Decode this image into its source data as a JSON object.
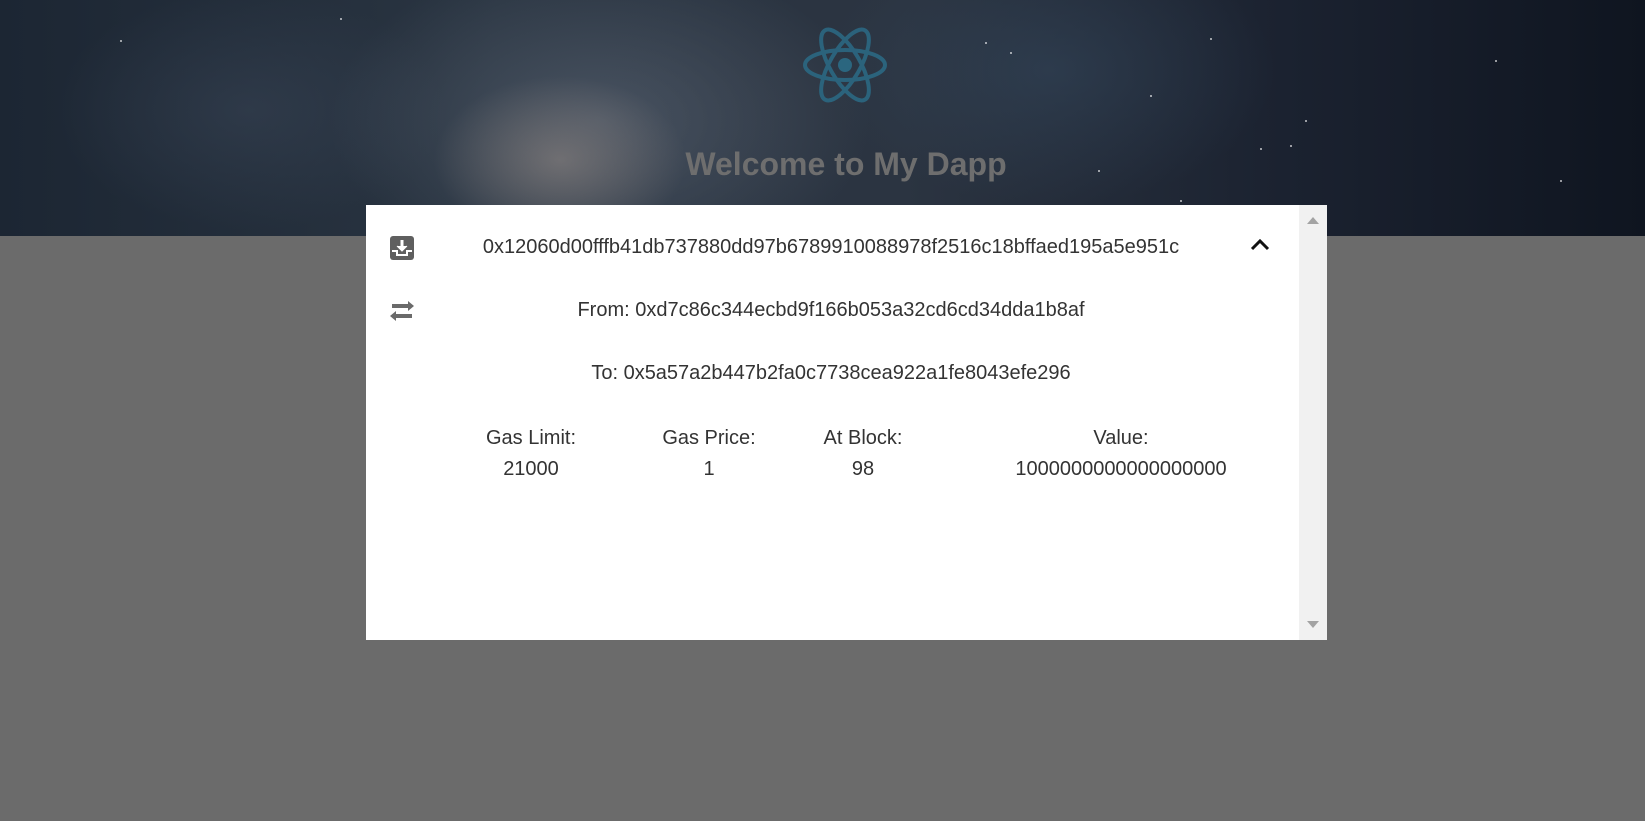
{
  "header": {
    "title": "Welcome to My Dapp",
    "logo_icon": "react-atom-icon",
    "logo_color": "#2b6b86"
  },
  "transaction": {
    "hash": "0x12060d00fffb41db737880dd97b6789910088978f2516c18bffaed195a5e951c",
    "from_label": "From: 0xd7c86c344ecbd9f166b053a32cd6cd34dda1b8af",
    "to_label": "To: 0x5a57a2b447b2fa0c7738cea922a1fe8043efe296",
    "stats": [
      {
        "label": "Gas Limit:",
        "value": "21000"
      },
      {
        "label": "Gas Price:",
        "value": "1"
      },
      {
        "label": "At Block:",
        "value": "98"
      },
      {
        "label": "Value:",
        "value": "1000000000000000000"
      }
    ],
    "icons": {
      "tx_type": "download-box-icon",
      "transfer": "swap-arrows-icon",
      "toggle": "chevron-up-icon"
    }
  }
}
